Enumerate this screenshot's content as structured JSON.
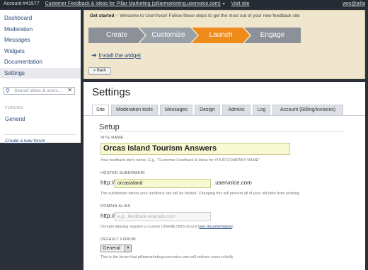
{
  "topbar": {
    "account": "Account #41577",
    "site_link": "Customer Feedback & Ideas for Pillar Marketing (pillarmarketing.uservoice.com)",
    "caret": "▼",
    "visit": "Visit site",
    "user": "wes@pilla"
  },
  "sidebar": {
    "items": [
      {
        "label": "Dashboard"
      },
      {
        "label": "Moderation"
      },
      {
        "label": "Messages"
      },
      {
        "label": "Widgets"
      },
      {
        "label": "Documentation"
      },
      {
        "label": "Settings"
      }
    ],
    "search_placeholder": "Search ideas & users...",
    "forum_label": "FORUMS",
    "forum_general": "General",
    "create_forum": "Create a new forum"
  },
  "getting_started": {
    "heading": "Get started",
    "text": " -- Welcome to UserVoice! Follow these steps to get the most out of your new feedback site",
    "steps": [
      "Create",
      "Customize",
      "Launch",
      "Engage"
    ],
    "active_step": "Launch",
    "install": "Install the widget",
    "back": "« Back"
  },
  "settings": {
    "title": "Settings",
    "tabs": [
      "Site",
      "Moderation tools",
      "Messages",
      "Design",
      "Admins",
      "Log",
      "Account (Billing/Invoices)"
    ],
    "active_tab": "Site",
    "section": "Setup",
    "site_name_label": "SITE NAME",
    "site_name": "Orcas Island Tourism Answers",
    "site_name_help": "Your feedback site's name. E.g., \"Customer Feedback & Ideas for YOUR COMPANY NAME\"",
    "subdomain_label": "HOSTED SUBDOMAIN",
    "subdomain_prefix": "http://",
    "subdomain": "orcasisland",
    "subdomain_suffix": ".uservoice.com",
    "subdomain_help": "The subdomain where your feedback site will be hosted. Changing this will prevent all of your old links from working.",
    "alias_label": "DOMAIN ALIAS",
    "alias_prefix": "http://",
    "alias_placeholder": "e.g., feedback.example.com",
    "alias_help": "Domain aliasing requires a custom CNAME DNS record (",
    "alias_help_link": "see documentation",
    "alias_help_end": ")",
    "forum_label": "DEFAULT FORUM",
    "forum_value": "General",
    "forum_help": "This is the forum that pillarmarketing.uservoice.com will redirect users initially"
  },
  "colors": {
    "accent": "#ee8b1a",
    "step_inactive": "#8c9199",
    "banner": "#efe6cd",
    "topbar": "#262b33"
  }
}
